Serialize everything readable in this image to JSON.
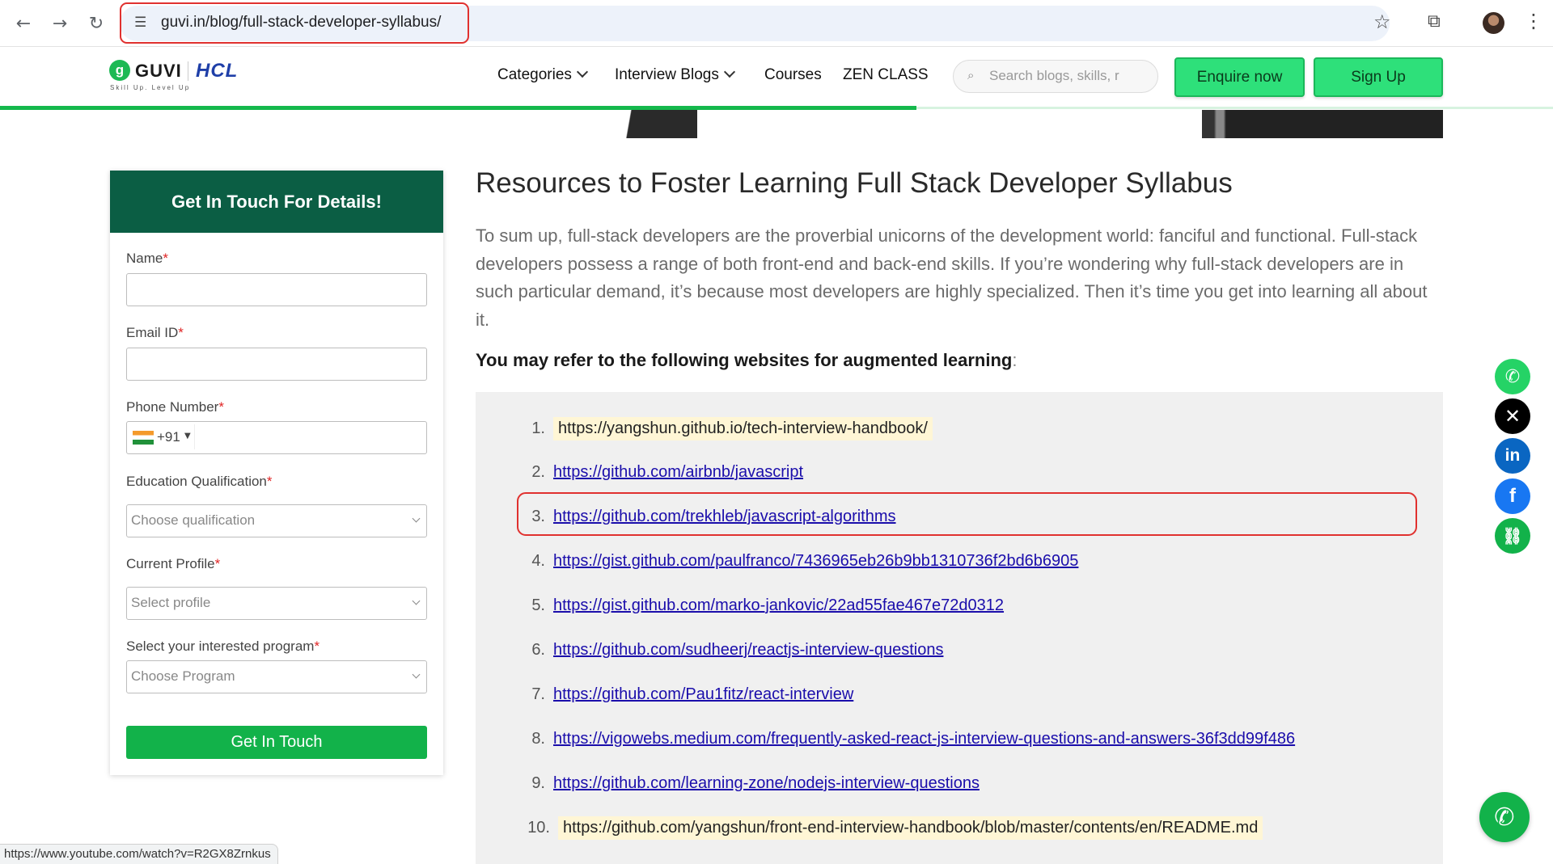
{
  "browser": {
    "url": "guvi.in/blog/full-stack-developer-syllabus/",
    "status_url": "https://www.youtube.com/watch?v=R2GX8Zrnkus"
  },
  "header": {
    "logo_letter": "g",
    "logo_text": "GUVI",
    "partner_text": "HCL",
    "tagline": "Skill Up. Level Up",
    "nav": [
      "Categories",
      "Interview Blogs",
      "Courses",
      "ZEN CLASS"
    ],
    "search_placeholder": "Search blogs, skills, r",
    "enquire_label": "Enquire now",
    "signup_label": "Sign Up"
  },
  "form": {
    "title": "Get In Touch For Details!",
    "fields": {
      "name": "Name",
      "email": "Email ID",
      "phone": "Phone Number",
      "education": "Education Qualification",
      "profile": "Current Profile",
      "program": "Select your interested program"
    },
    "required_mark": "*",
    "phone_code": "+91",
    "education_placeholder": "Choose qualification",
    "profile_placeholder": "Select profile",
    "program_placeholder": "Choose Program",
    "submit_label": "Get In Touch"
  },
  "article": {
    "title": "Resources to Foster Learning Full Stack Developer Syllabus",
    "paragraph": "To sum up, full-stack developers are the proverbial unicorns of the development world: fanciful and functional. Full-stack developers possess a range of both front-end and back-end skills. If you’re wondering why full-stack developers are in such particular demand, it’s because most developers are highly specialized. Then it’s time you get into learning all about it.",
    "lead": "You may refer to the following websites for augmented learning",
    "lead_colon": ":",
    "links": [
      {
        "num": "1.",
        "text": "https://yangshun.github.io/tech-interview-handbook/"
      },
      {
        "num": "2.",
        "text": "https://github.com/airbnb/javascript"
      },
      {
        "num": "3.",
        "text": "https://github.com/trekhleb/javascript-algorithms"
      },
      {
        "num": "4.",
        "text": "https://gist.github.com/paulfranco/7436965eb26b9bb1310736f2bd6b6905"
      },
      {
        "num": "5.",
        "text": "https://gist.github.com/marko-jankovic/22ad55fae467e72d0312"
      },
      {
        "num": "6.",
        "text": "https://github.com/sudheerj/reactjs-interview-questions"
      },
      {
        "num": "7.",
        "text": "https://github.com/Pau1fitz/react-interview"
      },
      {
        "num": "8.",
        "text": "https://vigowebs.medium.com/frequently-asked-react-js-interview-questions-and-answers-36f3dd99f486"
      },
      {
        "num": "9.",
        "text": "https://github.com/learning-zone/nodejs-interview-questions"
      },
      {
        "num": "10.",
        "text": "https://github.com/yangshun/front-end-interview-handbook/blob/master/contents/en/README.md"
      }
    ]
  },
  "share": {
    "whatsapp_color": "#25d366",
    "x_color": "#000000",
    "linkedin_color": "#0a66c2",
    "facebook_color": "#1877f2",
    "link_color": "#12b24a"
  }
}
